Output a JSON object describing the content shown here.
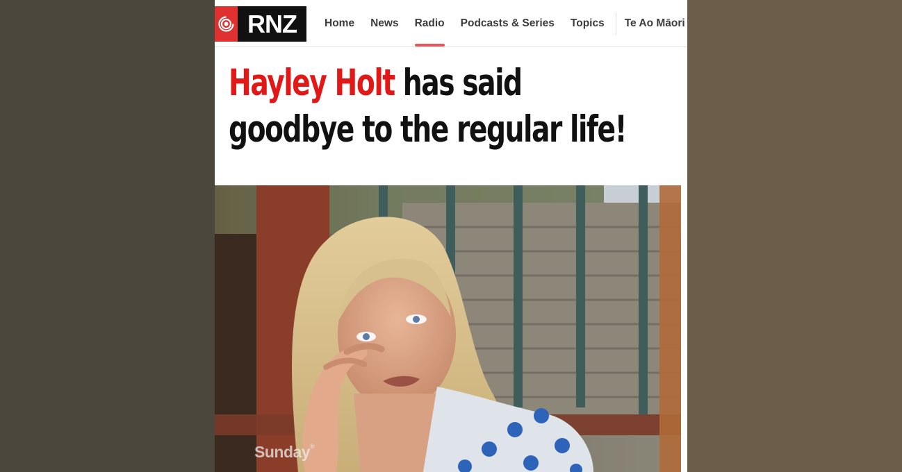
{
  "brand": {
    "logo_text": "RNZ",
    "accent": "#e03131"
  },
  "nav": {
    "items": [
      {
        "label": "Home",
        "active": false
      },
      {
        "label": "News",
        "active": false
      },
      {
        "label": "Radio",
        "active": true
      },
      {
        "label": "Podcasts & Series",
        "active": false
      },
      {
        "label": "Topics",
        "active": false
      },
      {
        "label": "Te Ao Māori",
        "active": false
      }
    ],
    "active_underline_color": "#e9545a"
  },
  "headline": {
    "highlight": "Hayley Holt",
    "rest_line1": " has said",
    "line2": "goodbye to the regular life!",
    "highlight_color": "#e01818"
  },
  "photo": {
    "watermark": "Sunday",
    "watermark_mark": "®"
  }
}
